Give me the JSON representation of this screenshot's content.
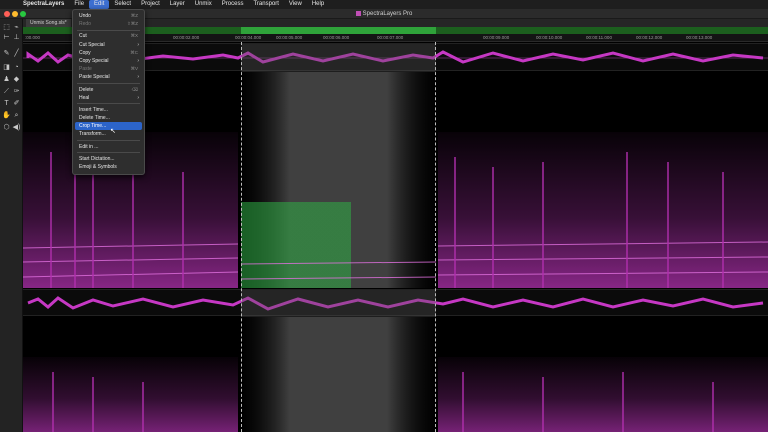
{
  "menubar": {
    "apple": "",
    "items": [
      "SpectraLayers",
      "File",
      "Edit",
      "Select",
      "Project",
      "Layer",
      "Unmix",
      "Process",
      "Transport",
      "View",
      "Help"
    ],
    "active_index": 2
  },
  "window": {
    "title": "SpectraLayers Pro",
    "tab": "Unmix Song.sls*"
  },
  "ruler": {
    "ticks": [
      "00:00:02.000",
      "00:00:03.000",
      "00:00:04.000",
      "00:00:05.000",
      "00:00:06.000",
      "00:00:07.000",
      "00:00:08.000",
      "00:00:09.000",
      "00:00:10.000",
      "00:00:11.000",
      "00:00:12.000",
      "00:00:13.000"
    ],
    "first_tick": ":00.000"
  },
  "edit_menu": {
    "items": [
      {
        "label": "Undo",
        "shortcut": "⌘Z"
      },
      {
        "label": "Redo",
        "shortcut": "⇧⌘Z",
        "disabled": true
      },
      {
        "sep": true
      },
      {
        "label": "Cut",
        "shortcut": "⌘X"
      },
      {
        "label": "Cut Special",
        "submenu": true
      },
      {
        "label": "Copy",
        "shortcut": "⌘C"
      },
      {
        "label": "Copy Special",
        "submenu": true
      },
      {
        "label": "Paste",
        "shortcut": "⌘V",
        "disabled": true
      },
      {
        "label": "Paste Special",
        "submenu": true
      },
      {
        "sep": true
      },
      {
        "label": "Delete",
        "shortcut": "⌫"
      },
      {
        "label": "Heal",
        "submenu": true
      },
      {
        "sep": true
      },
      {
        "label": "Insert Time..."
      },
      {
        "label": "Delete Time..."
      },
      {
        "label": "Crop Time...",
        "highlighted": true
      },
      {
        "label": "Transform..."
      },
      {
        "sep": true
      },
      {
        "label": "Edit in ..."
      },
      {
        "sep": true
      },
      {
        "label": "Start Dictation..."
      },
      {
        "label": "Emoji & Symbols"
      }
    ]
  },
  "colors": {
    "spectrum_magenta": "#c638c4",
    "spectrum_green": "#2fae45",
    "selection_highlight": "#2c64c9",
    "overview_green": "#2fa33a"
  },
  "tools": [
    "select-rect-icon",
    "lasso-icon",
    "time-select-icon",
    "brush-icon",
    "line-icon",
    "eraser-icon",
    "clone-icon",
    "stamp-icon",
    "fill-icon",
    "eyedropper-icon",
    "text-icon",
    "pen-icon",
    "hand-icon",
    "zoom-icon",
    "cube-icon",
    "speaker-icon"
  ]
}
